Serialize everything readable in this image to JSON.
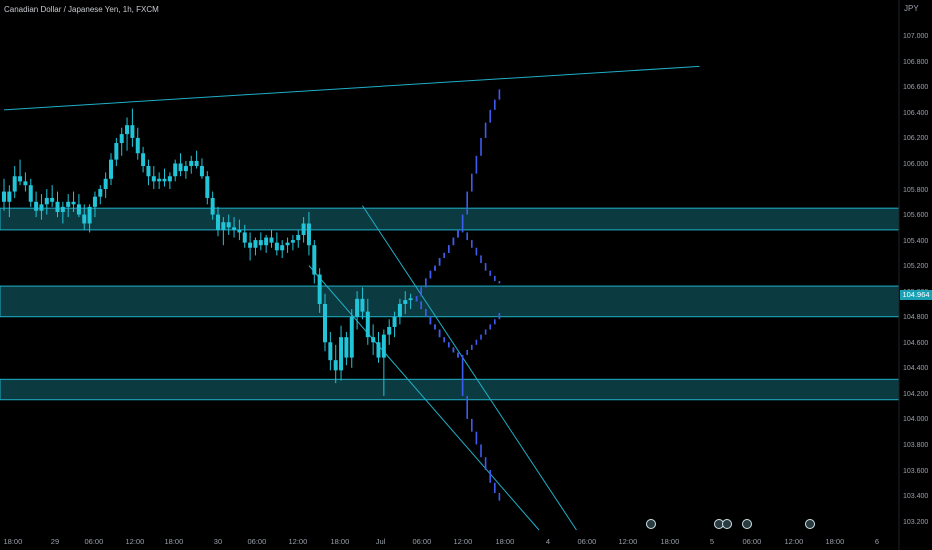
{
  "header": {
    "title": "Canadian Dollar / Japanese Yen, 1h, FXCM",
    "currency": "JPY"
  },
  "price_label": "104.964",
  "colors": {
    "candle": "#22c4d8",
    "projection": "#3f5cf0",
    "zone_fill": "#0b3a40",
    "zone_line": "#1fb0c8",
    "trendline": "#1fb0c8"
  },
  "event_markers": [
    "earnings-icon",
    "earnings-icon",
    "earnings-icon",
    "earnings-icon",
    "earnings-icon"
  ],
  "chart_data": {
    "type": "candlestick",
    "title": "Canadian Dollar / Japanese Yen, 1h, FXCM",
    "y_unit": "JPY",
    "ylim": [
      103.15,
      107.3
    ],
    "y_ticks": [
      "107.000",
      "106.800",
      "106.600",
      "106.400",
      "106.200",
      "106.000",
      "105.800",
      "105.600",
      "105.400",
      "105.200",
      "105.000",
      "104.800",
      "104.600",
      "104.400",
      "104.200",
      "104.000",
      "103.800",
      "103.600",
      "103.400",
      "103.200"
    ],
    "x_ticks": [
      "18:00",
      "29",
      "06:00",
      "12:00",
      "18:00",
      "30",
      "06:00",
      "12:00",
      "18:00",
      "Jul",
      "06:00",
      "12:00",
      "18:00",
      "4",
      "06:00",
      "12:00",
      "18:00",
      "5",
      "06:00",
      "12:00",
      "18:00",
      "6"
    ],
    "last_price": 104.964,
    "zones": [
      {
        "top": 105.67,
        "bottom": 105.5
      },
      {
        "top": 105.06,
        "bottom": 104.82
      },
      {
        "top": 104.33,
        "bottom": 104.17
      }
    ],
    "trendlines": [
      {
        "from": [
          0,
          106.44
        ],
        "to": [
          130,
          106.78
        ]
      },
      {
        "from": [
          67,
          105.69
        ],
        "to": [
          107,
          103.15
        ]
      },
      {
        "from": [
          57,
          105.22
        ],
        "to": [
          100,
          103.15
        ]
      }
    ],
    "candles": [
      [
        105.8,
        105.9,
        105.65,
        105.72
      ],
      [
        105.72,
        105.85,
        105.6,
        105.8
      ],
      [
        105.8,
        106.0,
        105.75,
        105.92
      ],
      [
        105.92,
        106.05,
        105.85,
        105.88
      ],
      [
        105.88,
        105.95,
        105.8,
        105.85
      ],
      [
        105.85,
        105.9,
        105.68,
        105.72
      ],
      [
        105.72,
        105.8,
        105.6,
        105.65
      ],
      [
        105.65,
        105.78,
        105.58,
        105.7
      ],
      [
        105.7,
        105.82,
        105.62,
        105.75
      ],
      [
        105.75,
        105.85,
        105.68,
        105.72
      ],
      [
        105.72,
        105.8,
        105.6,
        105.64
      ],
      [
        105.64,
        105.72,
        105.55,
        105.68
      ],
      [
        105.68,
        105.78,
        105.6,
        105.72
      ],
      [
        105.72,
        105.8,
        105.64,
        105.7
      ],
      [
        105.7,
        105.78,
        105.6,
        105.62
      ],
      [
        105.62,
        105.7,
        105.5,
        105.55
      ],
      [
        105.55,
        105.7,
        105.48,
        105.68
      ],
      [
        105.68,
        105.8,
        105.6,
        105.76
      ],
      [
        105.76,
        105.85,
        105.7,
        105.82
      ],
      [
        105.82,
        105.95,
        105.75,
        105.9
      ],
      [
        105.9,
        106.1,
        105.85,
        106.05
      ],
      [
        106.05,
        106.22,
        106.0,
        106.18
      ],
      [
        106.18,
        106.3,
        106.08,
        106.25
      ],
      [
        106.25,
        106.38,
        106.12,
        106.32
      ],
      [
        106.32,
        106.45,
        106.15,
        106.22
      ],
      [
        106.22,
        106.3,
        106.05,
        106.1
      ],
      [
        106.1,
        106.15,
        105.95,
        106.0
      ],
      [
        106.0,
        106.05,
        105.85,
        105.92
      ],
      [
        105.92,
        106.0,
        105.82,
        105.88
      ],
      [
        105.88,
        105.95,
        105.82,
        105.9
      ],
      [
        105.9,
        105.98,
        105.84,
        105.88
      ],
      [
        105.88,
        105.95,
        105.82,
        105.92
      ],
      [
        105.92,
        106.05,
        105.88,
        106.02
      ],
      [
        106.02,
        106.1,
        105.92,
        105.96
      ],
      [
        105.96,
        106.04,
        105.9,
        106.0
      ],
      [
        106.0,
        106.08,
        105.94,
        106.04
      ],
      [
        106.04,
        106.12,
        105.98,
        106.0
      ],
      [
        106.0,
        106.06,
        105.9,
        105.92
      ],
      [
        105.92,
        105.96,
        105.7,
        105.75
      ],
      [
        105.75,
        105.8,
        105.58,
        105.62
      ],
      [
        105.62,
        105.68,
        105.45,
        105.5
      ],
      [
        105.5,
        105.6,
        105.38,
        105.56
      ],
      [
        105.56,
        105.62,
        105.46,
        105.52
      ],
      [
        105.52,
        105.6,
        105.44,
        105.5
      ],
      [
        105.5,
        105.58,
        105.42,
        105.48
      ],
      [
        105.48,
        105.54,
        105.36,
        105.4
      ],
      [
        105.4,
        105.48,
        105.26,
        105.36
      ],
      [
        105.36,
        105.44,
        105.3,
        105.42
      ],
      [
        105.42,
        105.48,
        105.34,
        105.38
      ],
      [
        105.38,
        105.46,
        105.32,
        105.44
      ],
      [
        105.44,
        105.5,
        105.36,
        105.4
      ],
      [
        105.4,
        105.48,
        105.3,
        105.34
      ],
      [
        105.34,
        105.42,
        105.28,
        105.38
      ],
      [
        105.38,
        105.44,
        105.32,
        105.4
      ],
      [
        105.4,
        105.46,
        105.34,
        105.42
      ],
      [
        105.42,
        105.5,
        105.36,
        105.46
      ],
      [
        105.46,
        105.6,
        105.4,
        105.55
      ],
      [
        105.55,
        105.64,
        105.3,
        105.38
      ],
      [
        105.38,
        105.42,
        105.08,
        105.15
      ],
      [
        105.15,
        105.2,
        104.85,
        104.92
      ],
      [
        104.92,
        105.0,
        104.55,
        104.62
      ],
      [
        104.62,
        104.7,
        104.4,
        104.48
      ],
      [
        104.48,
        104.6,
        104.3,
        104.4
      ],
      [
        104.4,
        104.75,
        104.32,
        104.66
      ],
      [
        104.66,
        104.7,
        104.44,
        104.5
      ],
      [
        104.5,
        104.88,
        104.42,
        104.82
      ],
      [
        104.82,
        105.02,
        104.72,
        104.96
      ],
      [
        104.96,
        105.05,
        104.8,
        104.86
      ],
      [
        104.86,
        104.96,
        104.6,
        104.66
      ],
      [
        104.66,
        104.76,
        104.52,
        104.62
      ],
      [
        104.62,
        104.7,
        104.46,
        104.5
      ],
      [
        104.5,
        104.72,
        104.2,
        104.68
      ],
      [
        104.68,
        104.8,
        104.6,
        104.74
      ],
      [
        104.74,
        104.86,
        104.66,
        104.82
      ],
      [
        104.82,
        104.96,
        104.76,
        104.92
      ],
      [
        104.92,
        105.02,
        104.84,
        104.95
      ],
      [
        104.95,
        105.0,
        104.88,
        104.964
      ]
    ],
    "projections": [
      {
        "name": "",
        "values": [
          104.98,
          105.05,
          105.12,
          105.18,
          105.22,
          105.28,
          105.32,
          105.38,
          105.44,
          105.5,
          105.62,
          105.8,
          105.94,
          106.08,
          106.22,
          106.34,
          106.44,
          106.52,
          106.6
        ]
      },
      {
        "name": "",
        "values": [
          104.98,
          105.05,
          105.12,
          105.18,
          105.22,
          105.28,
          105.32,
          105.38,
          105.44,
          105.5,
          105.48,
          105.42,
          105.36,
          105.3,
          105.24,
          105.18,
          105.14,
          105.1,
          105.08
        ]
      },
      {
        "name": "",
        "values": [
          104.94,
          104.88,
          104.82,
          104.76,
          104.72,
          104.66,
          104.62,
          104.58,
          104.54,
          104.5,
          104.52,
          104.56,
          104.6,
          104.64,
          104.68,
          104.72,
          104.76,
          104.8,
          104.85
        ]
      },
      {
        "name": "",
        "values": [
          104.94,
          104.88,
          104.82,
          104.76,
          104.72,
          104.66,
          104.62,
          104.58,
          104.54,
          104.5,
          104.2,
          104.02,
          103.92,
          103.82,
          103.72,
          103.62,
          103.52,
          103.44,
          103.38
        ]
      }
    ]
  }
}
